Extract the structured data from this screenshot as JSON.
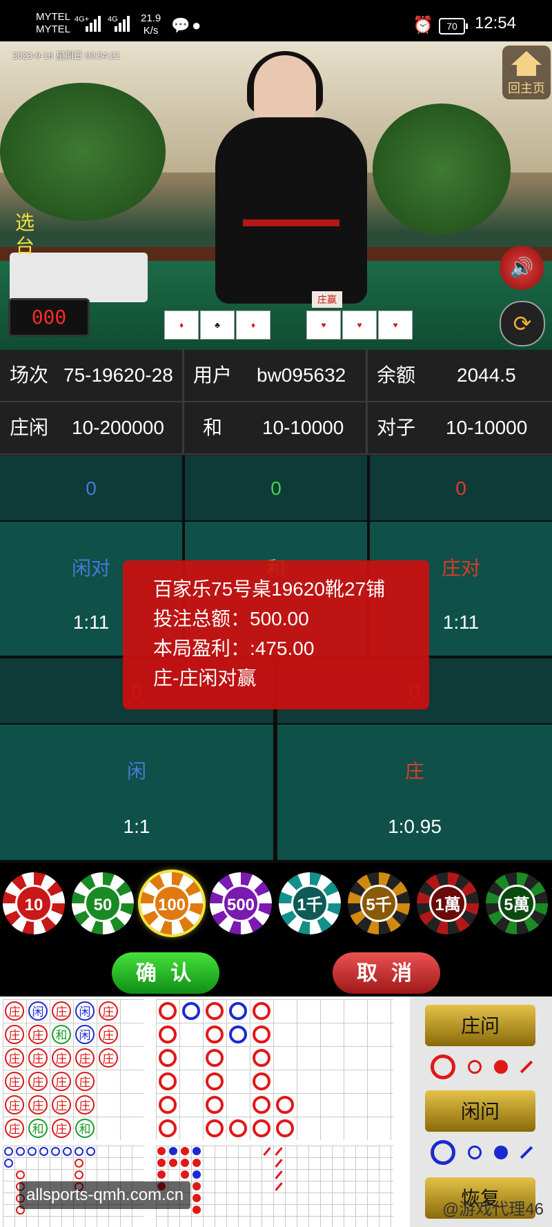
{
  "status_bar": {
    "carrier1": "MYTEL",
    "carrier2": "MYTEL",
    "net1": "4G+",
    "net2": "4G",
    "speed_value": "21.9",
    "speed_unit": "K/s",
    "battery": "70",
    "time": "12:54"
  },
  "video": {
    "timestamp": "2023-9-16 星期日 00:54:21",
    "home_label": "回主页",
    "select_table_label": "选台",
    "counter": "000",
    "card_label": "庄赢",
    "volume_icon": "speaker-icon",
    "sync_icon": "refresh-icon"
  },
  "info": {
    "round_label": "场次",
    "round_value": "75-19620-28",
    "user_label": "用户",
    "user_value": "bw095632",
    "balance_label": "余额",
    "balance_value": "2044.5",
    "bp_label": "庄闲",
    "bp_limit": "10-200000",
    "tie_label": "和",
    "tie_limit": "10-10000",
    "pair_label": "对子",
    "pair_limit": "10-10000"
  },
  "bets": {
    "player_pair": {
      "amount": "0",
      "name": "闲对",
      "odds": "1:11"
    },
    "tie": {
      "amount": "0",
      "name": "和",
      "odds": ""
    },
    "banker_pair": {
      "amount": "0",
      "name": "庄对",
      "odds": "1:11"
    },
    "player": {
      "amount": "0",
      "name": "闲",
      "odds": "1:1"
    },
    "banker": {
      "amount": "0",
      "name": "庄",
      "odds": "1:0.95"
    }
  },
  "popup": {
    "line1": "百家乐75号桌19620靴27铺",
    "line2": "投注总额：500.00",
    "line3": "本局盈利：:475.00",
    "line4": "庄-庄闲对赢"
  },
  "chips": [
    "10",
    "50",
    "100",
    "500",
    "1千",
    "5千",
    "1萬",
    "5萬"
  ],
  "selected_chip": "100",
  "actions": {
    "confirm": "确 认",
    "cancel": "取 消"
  },
  "road": {
    "bead_rows": [
      [
        "庄",
        "闲",
        "庄",
        "闲",
        "庄"
      ],
      [
        "庄",
        "庄",
        "和",
        "闲",
        "庄"
      ],
      [
        "庄",
        "庄",
        "庄",
        "庄",
        "庄"
      ],
      [
        "庄",
        "庄",
        "庄",
        "庄",
        ""
      ],
      [
        "庄",
        "庄",
        "庄",
        "庄",
        ""
      ],
      [
        "庄",
        "和",
        "庄",
        "和",
        ""
      ]
    ],
    "ask_banker": "庄问",
    "ask_player": "闲问",
    "restore": "恢复"
  },
  "colors": {
    "banker_red": "#e01818",
    "player_blue": "#1a2ad0",
    "tie_green": "#1a9a2a",
    "bet_green": "#0f5048"
  },
  "watermark": "allsports-qmh.com.cn",
  "watermark2": "@游戏代理46"
}
